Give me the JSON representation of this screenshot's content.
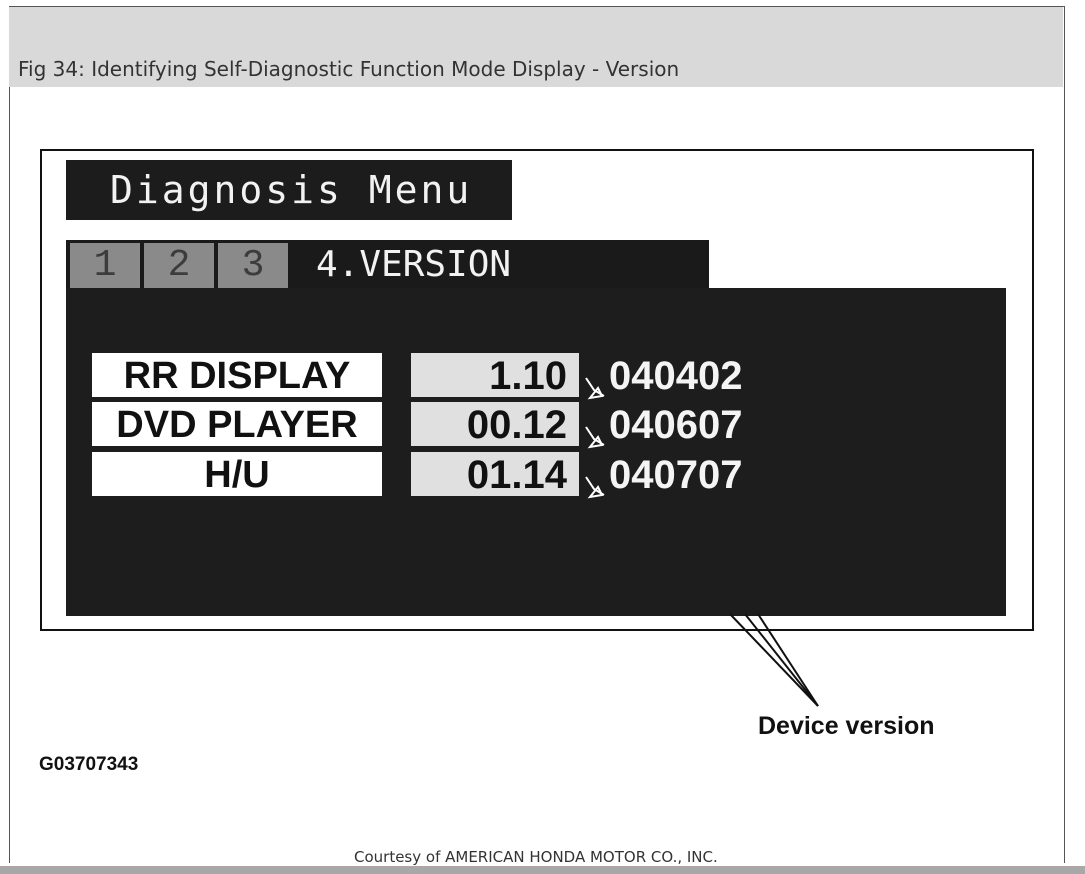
{
  "caption": "Fig 34: Identifying Self-Diagnostic Function Mode Display - Version",
  "screen": {
    "title": "Diagnosis Menu",
    "tabs": [
      {
        "label": "1"
      },
      {
        "label": "2"
      },
      {
        "label": "3"
      }
    ],
    "active_tab": "4.VERSION",
    "devices": [
      {
        "name": "RR DISPLAY",
        "version": "1.10",
        "date": "040402"
      },
      {
        "name": "DVD PLAYER",
        "version": "00.12",
        "date": "040607"
      },
      {
        "name": "H/U",
        "version": "01.14",
        "date": "040707"
      }
    ]
  },
  "callout": "Device version",
  "figure_code": "G03707343",
  "courtesy": "Courtesy of AMERICAN HONDA MOTOR CO., INC."
}
